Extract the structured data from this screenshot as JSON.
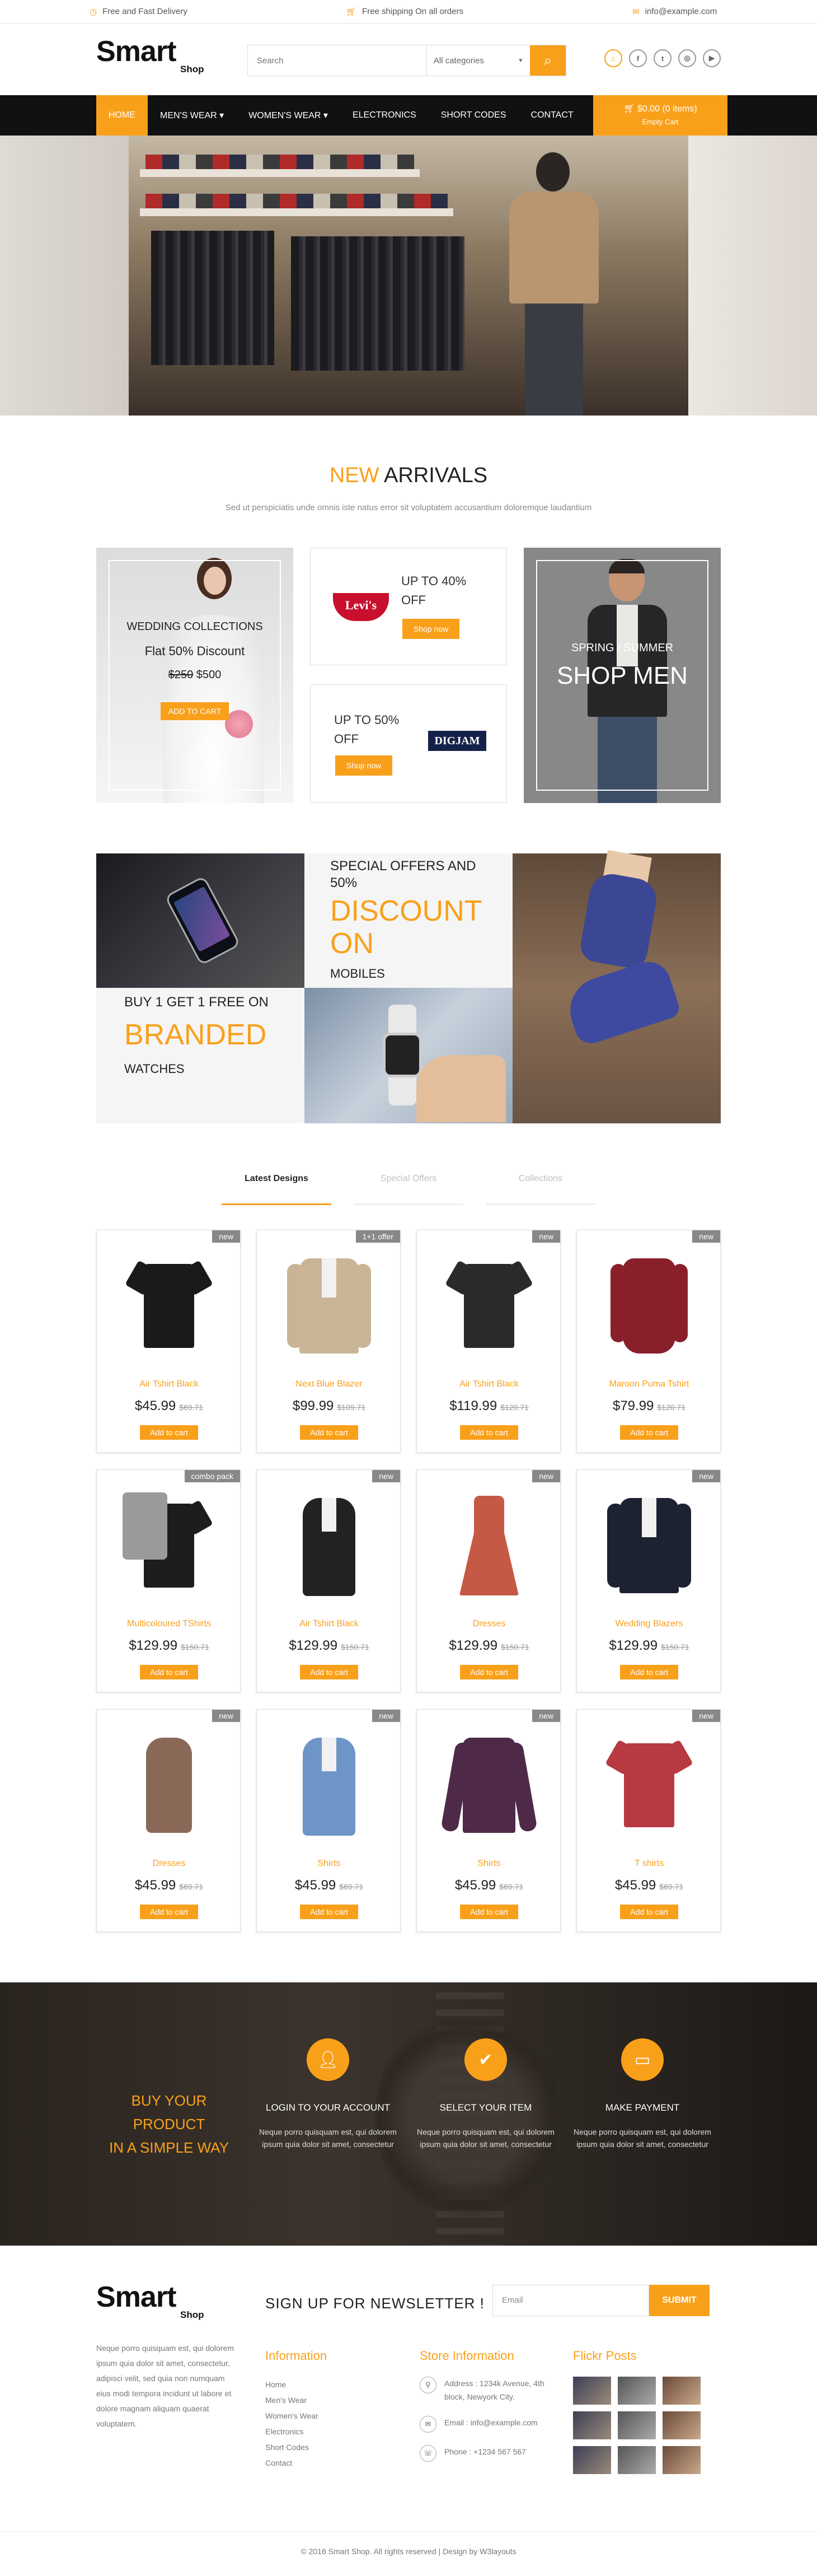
{
  "topbar": {
    "delivery": "Free and Fast Delivery",
    "shipping": "Free shipping On all orders",
    "email": "info@example.com"
  },
  "header": {
    "logo_main": "Smart",
    "logo_sub": "Shop",
    "search_placeholder": "Search",
    "category_selected": "All categories",
    "social_icons": [
      "shop-icon",
      "facebook-icon",
      "twitter-icon",
      "dribbble-icon",
      "youtube-icon"
    ]
  },
  "nav": {
    "items": [
      "HOME",
      "MEN'S WEAR ▾",
      "WOMEN'S WEAR ▾",
      "ELECTRONICS",
      "SHORT CODES",
      "CONTACT"
    ],
    "cart_total": "$0.00 (0 items)",
    "cart_label": "Empty Cart"
  },
  "arrivals": {
    "title_accent": "NEW",
    "title_rest": "ARRIVALS",
    "subtitle": "Sed ut perspiciatis unde omnis iste natus error sit voluptatem accusantium doloremque laudantium",
    "wedding": {
      "title": "WEDDING COLLECTIONS",
      "discount": "Flat 50% Discount",
      "old_price": "$250",
      "new_price": "$500",
      "button": "ADD TO CART"
    },
    "levis": {
      "offer_line1": "UP TO 40%",
      "offer_line2": "OFF",
      "brand": "Levi's",
      "button": "Shop now"
    },
    "digjam": {
      "offer_line1": "UP TO 50%",
      "offer_line2": "OFF",
      "brand": "DIGJAM",
      "button": "Shop now"
    },
    "men": {
      "small": "SPRING / SUMMER",
      "big": "SHOP MEN"
    }
  },
  "promo": {
    "special_line1": "SPECIAL OFFERS AND",
    "special_line2": "50%",
    "discount_line1": "DISCOUNT",
    "discount_line2": "ON",
    "mobiles": "MOBILES",
    "buy": "BUY 1 GET 1 FREE ON",
    "branded": "BRANDED",
    "watches": "WATCHES"
  },
  "tabs": [
    "Latest Designs",
    "Special Offers",
    "Collections"
  ],
  "products": [
    {
      "tag": "new",
      "name": "Air Tshirt Black",
      "price": "$45.99",
      "old": "$69.71",
      "button": "Add to cart"
    },
    {
      "tag": "1+1 offer",
      "name": "Next Blue Blazer",
      "price": "$99.99",
      "old": "$109.71",
      "button": "Add to cart"
    },
    {
      "tag": "new",
      "name": "Air Tshirt Black",
      "price": "$119.99",
      "old": "$120.71",
      "button": "Add to cart"
    },
    {
      "tag": "new",
      "name": "Maroon Puma Tshirt",
      "price": "$79.99",
      "old": "$120.71",
      "button": "Add to cart"
    },
    {
      "tag": "combo pack",
      "name": "Multicoloured TShirts",
      "price": "$129.99",
      "old": "$150.71",
      "button": "Add to cart"
    },
    {
      "tag": "new",
      "name": "Air Tshirt Black",
      "price": "$129.99",
      "old": "$150.71",
      "button": "Add to cart"
    },
    {
      "tag": "new",
      "name": "Dresses",
      "price": "$129.99",
      "old": "$150.71",
      "button": "Add to cart"
    },
    {
      "tag": "new",
      "name": "Wedding Blazers",
      "price": "$129.99",
      "old": "$150.71",
      "button": "Add to cart"
    },
    {
      "tag": "new",
      "name": "Dresses",
      "price": "$45.99",
      "old": "$69.71",
      "button": "Add to cart"
    },
    {
      "tag": "new",
      "name": "Shirts",
      "price": "$45.99",
      "old": "$69.71",
      "button": "Add to cart"
    },
    {
      "tag": "new",
      "name": "Shirts",
      "price": "$45.99",
      "old": "$69.71",
      "button": "Add to cart"
    },
    {
      "tag": "new",
      "name": "T shirts",
      "price": "$45.99",
      "old": "$69.71",
      "button": "Add to cart"
    }
  ],
  "product_colors": [
    "#1a1a1a",
    "#c9b595",
    "#2a2a2a",
    "#8a1f2c",
    "#1d1d1d",
    "#222222",
    "#c45a45",
    "#1c2230",
    "#8a6858",
    "#6d95c7",
    "#4e2a48",
    "#b73a42"
  ],
  "steps": {
    "heading_line1": "BUY YOUR PRODUCT",
    "heading_line2": "IN A SIMPLE WAY",
    "items": [
      {
        "icon": "user-icon",
        "title": "LOGIN TO YOUR ACCOUNT",
        "desc_line1": "Neque porro quisquam est, qui dolorem",
        "desc_line2": "ipsum quia dolor sit amet, consectetur"
      },
      {
        "icon": "check-icon",
        "title": "SELECT YOUR ITEM",
        "desc_line1": "Neque porro quisquam est, qui dolorem",
        "desc_line2": "ipsum quia dolor sit amet, consectetur"
      },
      {
        "icon": "credit-card-icon",
        "title": "MAKE PAYMENT",
        "desc_line1": "Neque porro quisquam est, qui dolorem",
        "desc_line2": "ipsum quia dolor sit amet, consectetur"
      }
    ]
  },
  "footer": {
    "newsletter": "SIGN UP FOR NEWSLETTER !",
    "email_placeholder": "Email",
    "submit": "SUBMIT",
    "about_lines": [
      "Neque porro quisquam est, qui dolorem",
      "ipsum quia dolor sit amet, consectetur,",
      "adipisci velit, sed quia non numquam",
      "eius modi tempora incidunt ut labore et",
      "dolore magnam aliquam quaerat",
      "voluptatem."
    ],
    "info_title": "Information",
    "info_links": [
      "Home",
      "Men's Wear",
      "Women's Wear",
      "Electronics",
      "Short Codes",
      "Contact"
    ],
    "store_title": "Store Information",
    "address_line1": "Address : 1234k Avenue, 4th",
    "address_line2": "block, Newyork City.",
    "email": "Email : info@example.com",
    "phone": "Phone : +1234 567 567",
    "flickr_title": "Flickr Posts",
    "copyright": "© 2016 Smart Shop. All rights reserved | Design by W3layouts"
  },
  "accent_color": "#f9a01b"
}
